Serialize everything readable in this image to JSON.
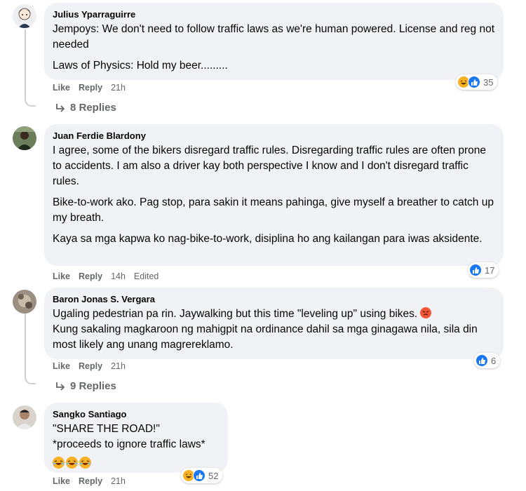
{
  "comments": [
    {
      "author": "Julius Yparraguirre",
      "paragraphs": [
        "Jempoys: We don't need to follow traffic laws as we're human powered. License and reg not needed",
        "Laws of Physics: Hold my beer........."
      ],
      "like_label": "Like",
      "reply_label": "Reply",
      "time": "21h",
      "reaction_count": "35",
      "replies_label": "8 Replies"
    },
    {
      "author": "Juan Ferdie Blardony",
      "paragraphs": [
        "I agree, some of the bikers disregard traffic rules. Disregarding traffic rules are often prone to accidents. I am also a driver kay both perspective I know and I don't disregard traffic rules.",
        "Bike-to-work ako. Pag stop, para sakin it means pahinga, give myself a breather to catch up my breath.",
        "Kaya sa mga kapwa ko nag-bike-to-work, disiplina ho ang kailangan para iwas aksidente."
      ],
      "like_label": "Like",
      "reply_label": "Reply",
      "time": "14h",
      "edited_label": "Edited",
      "reaction_count": "17"
    },
    {
      "author": "Baron Jonas S. Vergara",
      "paragraphs": [
        "Ugaling pedestrian pa rin. Jaywalking but this time \"leveling up\" using bikes.",
        "Kung sakaling magkaroon ng mahigpit na ordinance dahil sa mga ginagawa nila, sila din most likely ang unang magrereklamo."
      ],
      "like_label": "Like",
      "reply_label": "Reply",
      "time": "21h",
      "reaction_count": "6",
      "replies_label": "9 Replies"
    },
    {
      "author": "Sangko Santiago",
      "paragraphs": [
        "\"SHARE THE ROAD!\"",
        "*proceeds to ignore traffic laws*"
      ],
      "like_label": "Like",
      "reply_label": "Reply",
      "time": "21h",
      "reaction_count": "52"
    }
  ],
  "icons": {
    "reply_arrow": "reply-arrow-icon",
    "like": "like-reaction-icon",
    "haha": "haha-reaction-icon",
    "angry": "angry-emoji-icon"
  },
  "colors": {
    "bubble": "#f0f2f5",
    "secondary_text": "#65676b",
    "like_blue": "#1877f2",
    "haha_yellow": "#f7b125"
  }
}
